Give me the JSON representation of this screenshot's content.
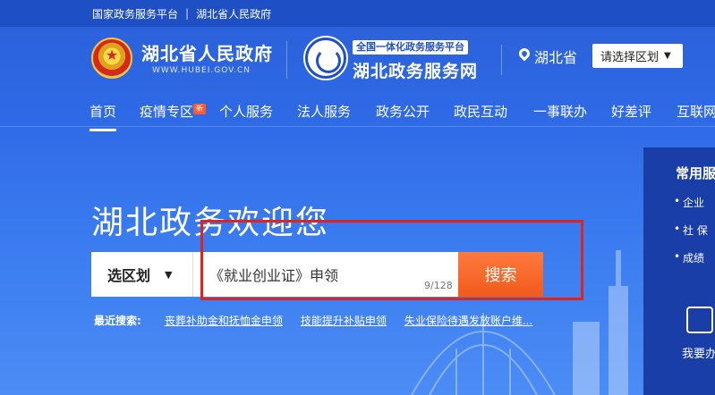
{
  "topbar": {
    "link1": "国家政务服务平台",
    "separator": "|",
    "link2": "湖北省人民政府"
  },
  "header": {
    "gov_name": "湖北省人民政府",
    "gov_url": "WWW.HUBEI.GOV.CN",
    "service_tag": "全国一体化政务服务平台",
    "service_name": "湖北政务服务网",
    "location": "湖北省",
    "region_button": "请选择区划"
  },
  "nav": {
    "items": [
      "首页",
      "疫情专区",
      "个人服务",
      "法人服务",
      "政务公开",
      "政民互动",
      "一事联办",
      "好差评",
      "互联网"
    ],
    "badge": "新"
  },
  "hero": {
    "welcome": "湖北政务欢迎您",
    "region_select": "选区划",
    "search_value": "《就业创业证》申领",
    "counter": "9/128",
    "search_button": "搜索"
  },
  "recent": {
    "label": "最近搜索:",
    "items": [
      "丧葬补助金和抚恤金申领",
      "技能提升补贴申领",
      "失业保险待遇发放账户维..."
    ]
  },
  "side_panel": {
    "title": "常用服",
    "items": [
      "企业",
      "社 保",
      "成绩"
    ],
    "bottom": "我要办"
  },
  "colors": {
    "primary": "#2f6ae6",
    "topbar": "#1f4fc4",
    "search_button": "#f15a1c",
    "highlight": "#e0241a"
  }
}
